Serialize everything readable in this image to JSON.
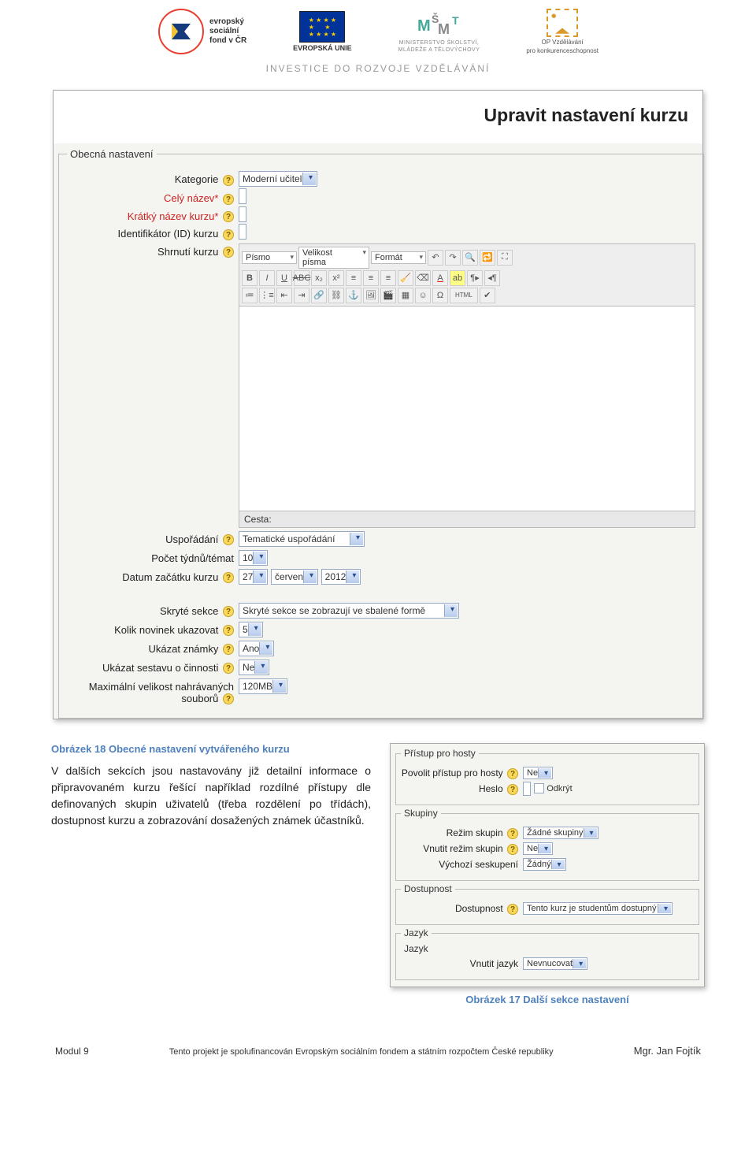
{
  "header": {
    "esf": {
      "line1": "evropský",
      "line2": "sociální",
      "line3": "fond v ČR"
    },
    "eu": "EVROPSKÁ UNIE",
    "msmt": {
      "line1": "MINISTERSTVO ŠKOLSTVÍ,",
      "line2": "MLÁDEŽE A TĚLOVÝCHOVY"
    },
    "op": {
      "line1": "OP Vzdělávání",
      "line2": "pro konkurenceschopnost"
    },
    "tagline": "INVESTICE DO ROZVOJE VZDĚLÁVÁNÍ"
  },
  "main_screenshot": {
    "title": "Upravit nastavení kurzu",
    "legend": "Obecná nastavení",
    "fields": {
      "kategorie": {
        "label": "Kategorie",
        "value": "Moderní učitel"
      },
      "cely_nazev": {
        "label": "Celý název",
        "star": "*"
      },
      "kratky_nazev": {
        "label": "Krátký název kurzu",
        "star": "*"
      },
      "id_kurzu": {
        "label": "Identifikátor (ID) kurzu"
      },
      "shrnuti": {
        "label": "Shrnutí kurzu"
      },
      "editor_sel": {
        "pismo": "Písmo",
        "velikost": "Velikost písma",
        "format": "Formát"
      },
      "cesta": "Cesta:",
      "usporadani": {
        "label": "Uspořádání",
        "value": "Tematické uspořádání"
      },
      "pocet_tydnu": {
        "label": "Počet týdnů/témat",
        "value": "10"
      },
      "datum": {
        "label": "Datum začátku kurzu",
        "day": "27",
        "month": "červen",
        "year": "2012"
      },
      "skryte_sekce": {
        "label": "Skryté sekce",
        "value": "Skryté sekce se zobrazují ve sbalené formě"
      },
      "novinky": {
        "label": "Kolik novinek ukazovat",
        "value": "5"
      },
      "znamky": {
        "label": "Ukázat známky",
        "value": "Ano"
      },
      "cinnost": {
        "label": "Ukázat sestavu o činnosti",
        "value": "Ne"
      },
      "max_velikost": {
        "label": "Maximální velikost nahrávaných souborů",
        "value": "120MB"
      }
    }
  },
  "captions": {
    "fig18": "Obrázek 18 Obecné nastavení vytvářeného kurzu",
    "fig17": "Obrázek 17 Další sekce nastavení"
  },
  "paragraph": "V dalších sekcích jsou nastavovány již detailní informace o připravovaném kurzu řešící například rozdílné přístupy dle definovaných skupin uživatelů (třeba rozdělení po třídách), dostupnost kurzu a zobrazování dosažených známek účastníků.",
  "side_screenshot": {
    "pristup": {
      "legend": "Přístup pro hosty",
      "povolit": {
        "label": "Povolit přístup pro hosty",
        "value": "Ne"
      },
      "heslo": {
        "label": "Heslo",
        "odkryt": "Odkrýt"
      }
    },
    "skupiny": {
      "legend": "Skupiny",
      "rezim": {
        "label": "Režim skupin",
        "value": "Žádné skupiny"
      },
      "vnutit": {
        "label": "Vnutit režim skupin",
        "value": "Ne"
      },
      "vychozi": {
        "label": "Výchozí seskupení",
        "value": "Žádný"
      }
    },
    "dostupnost": {
      "legend": "Dostupnost",
      "dostup": {
        "label": "Dostupnost",
        "value": "Tento kurz je studentům dostupný"
      }
    },
    "jazyk": {
      "legend": "Jazyk",
      "vnutit": {
        "label": "Vnutit jazyk",
        "value": "Nevnucovat"
      }
    }
  },
  "footer": {
    "left": "Modul 9",
    "mid": "Tento projekt je spolufinancován Evropským sociálním fondem a státním rozpočtem České republiky",
    "right": "Mgr. Jan Fojtík"
  }
}
